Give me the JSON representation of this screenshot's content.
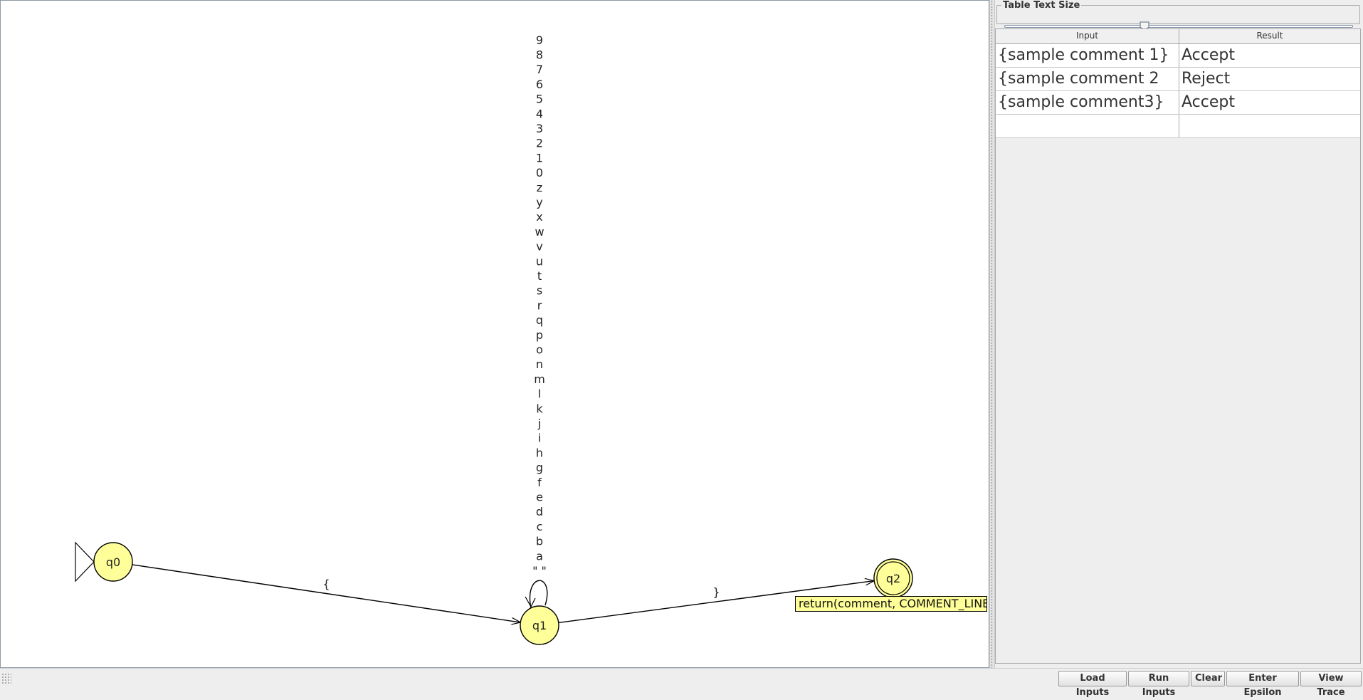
{
  "diagram": {
    "states": [
      {
        "id": "q0",
        "label": "q0",
        "initial": true,
        "final": false
      },
      {
        "id": "q1",
        "label": "q1",
        "initial": false,
        "final": false
      },
      {
        "id": "q2",
        "label": "q2",
        "initial": false,
        "final": true
      }
    ],
    "transitions": [
      {
        "from": "q0",
        "to": "q1",
        "label": "{"
      },
      {
        "from": "q1",
        "to": "q2",
        "label": "}"
      }
    ],
    "loop_labels": [
      "9",
      "8",
      "7",
      "6",
      "5",
      "4",
      "3",
      "2",
      "1",
      "0",
      "z",
      "y",
      "x",
      "w",
      "v",
      "u",
      "t",
      "s",
      "r",
      "q",
      "p",
      "o",
      "n",
      "m",
      "l",
      "k",
      "j",
      "i",
      "h",
      "g",
      "f",
      "e",
      "d",
      "c",
      "b",
      "a",
      "\" \""
    ],
    "state_note": "return(comment, COMMENT_LINE",
    "colors": {
      "state_fill": "#ffff99",
      "stroke": "#000000",
      "note_fill": "#ffff99"
    }
  },
  "right_panel": {
    "slider_title": "Table Text Size",
    "slider_value": 0.4,
    "table": {
      "columns": [
        "Input",
        "Result"
      ],
      "rows": [
        [
          "{sample comment 1}",
          "Accept"
        ],
        [
          "{sample comment 2",
          "Reject"
        ],
        [
          "{sample comment3}",
          "Accept"
        ],
        [
          "",
          ""
        ]
      ]
    }
  },
  "toolbar": {
    "buttons": [
      "Load Inputs",
      "Run Inputs",
      "Clear",
      "Enter Epsilon",
      "View Trace"
    ]
  }
}
